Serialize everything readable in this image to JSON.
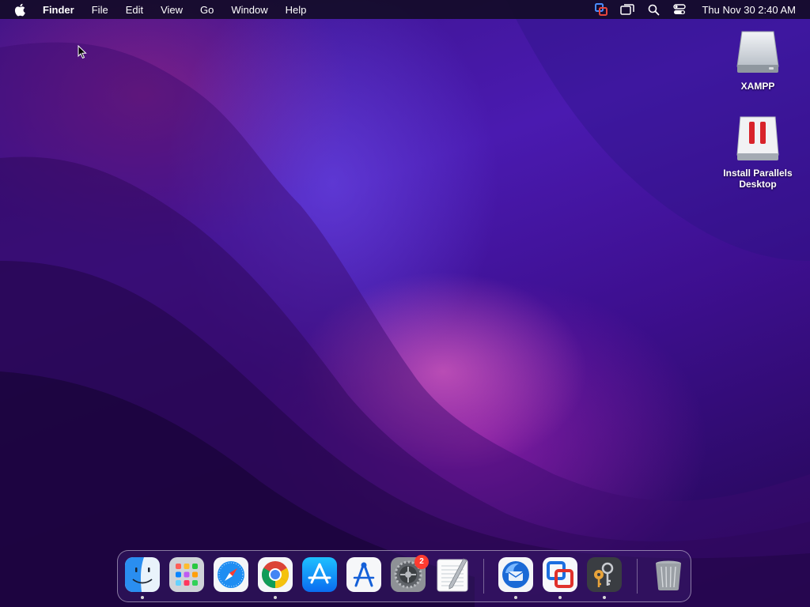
{
  "menubar": {
    "app_name": "Finder",
    "menus": [
      "File",
      "Edit",
      "View",
      "Go",
      "Window",
      "Help"
    ],
    "clock": "Thu Nov 30  2:40 AM"
  },
  "desktop": {
    "icons": [
      {
        "label": "XAMPP",
        "icon": "drive-icon"
      },
      {
        "label": "Install Parallels Desktop",
        "icon": "parallels-installer-icon"
      }
    ]
  },
  "dock": {
    "items": [
      {
        "name": "Finder",
        "icon": "finder-icon",
        "running": true
      },
      {
        "name": "Launchpad",
        "icon": "launchpad-icon",
        "running": false
      },
      {
        "name": "Safari",
        "icon": "safari-icon",
        "running": false
      },
      {
        "name": "Google Chrome",
        "icon": "chrome-icon",
        "running": true
      },
      {
        "name": "App Store",
        "icon": "app-store-icon",
        "running": false
      },
      {
        "name": "Instruments",
        "icon": "instruments-icon",
        "running": false
      },
      {
        "name": "System Settings",
        "icon": "settings-icon",
        "running": false,
        "badge": "2"
      },
      {
        "name": "TextEdit",
        "icon": "textedit-icon",
        "running": false
      },
      {
        "name": "Thunderbird",
        "icon": "thunderbird-icon",
        "running": true
      },
      {
        "name": "VMware Fusion",
        "icon": "vmware-icon",
        "running": true
      },
      {
        "name": "Keychain Access",
        "icon": "keychain-icon",
        "running": true
      },
      {
        "name": "Trash",
        "icon": "trash-icon",
        "running": false
      }
    ]
  },
  "colors": {
    "badge": "#ff3b30",
    "parallels_red": "#d8232a"
  }
}
